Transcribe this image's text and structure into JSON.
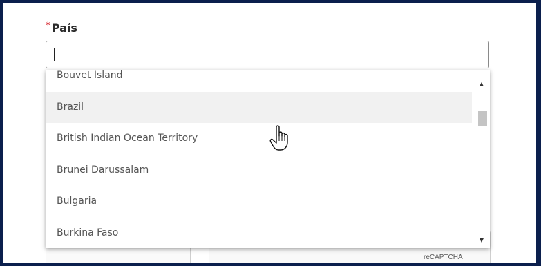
{
  "form": {
    "required_mark": "*",
    "country_label": "País",
    "country_value": ""
  },
  "dropdown": {
    "options": [
      "Bouvet Island",
      "Brazil",
      "British Indian Ocean Territory",
      "Brunei Darussalam",
      "Bulgaria",
      "Burkina Faso"
    ],
    "hovered_option": "Brazil",
    "scroll_position_fraction": 0.16
  },
  "background": {
    "recaptcha_label": "reCAPTCHA"
  },
  "colors": {
    "page_border": "#0b1f4d",
    "required_mark": "#d9363e",
    "hover_bg": "#f1f1f1"
  },
  "icons": {
    "cursor": "hand-pointer-icon",
    "scroll_up": "triangle-up-icon",
    "scroll_down": "triangle-down-icon"
  }
}
